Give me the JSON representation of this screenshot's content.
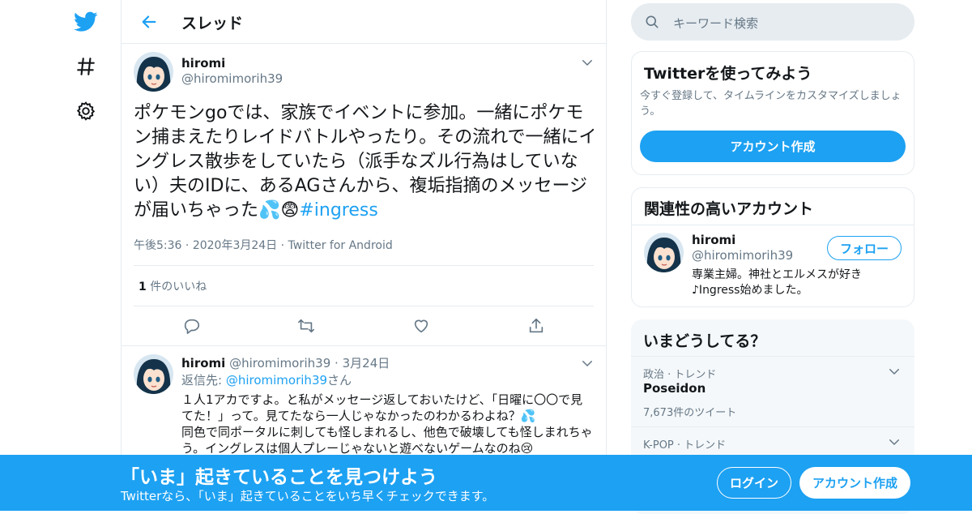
{
  "colors": {
    "accent": "#1da1f2",
    "text": "#14171a",
    "muted": "#657786",
    "border": "#e6ecf0"
  },
  "nav": {
    "icons": [
      "twitter-bird-icon",
      "hashtag-icon",
      "gear-icon"
    ]
  },
  "header": {
    "title": "スレッド"
  },
  "tweet": {
    "name": "hiromi",
    "handle": "@hiromimorih39",
    "text_main": "ポケモンgoでは、家族でイベントに参加。一緒にポケモン捕まえたりレイドバトルやったり。その流れで一緒にイングレス散歩をしていたら（派手なズル行為はしていない）夫のIDに、あるAGさんから、複垢指摘のメッセージが届いちゃった💦😨",
    "hashtag": "#ingress",
    "time": "午後5:36",
    "date": "2020年3月24日",
    "source": "Twitter for Android",
    "likes_count": "1",
    "likes_label": "件のいいね"
  },
  "reply": {
    "name": "hiromi",
    "handle": "@hiromimorih39",
    "date": "3月24日",
    "reply_to_prefix": "返信先:",
    "reply_to_handle": "@hiromimorih39",
    "reply_to_suffix": "さん",
    "text_line1": "１人1アカですよ。と私がメッセージ返しておいたけど、「日曜に〇〇で見てた！」って。見てたなら一人じゃなかったのわかるわよね？💦",
    "text_line2": "同色で同ポータルに刺しても怪しまれるし、他色で破壊しても怪しまれちゃう。イングレスは個人プレーじゃないと遊べないゲームなのね😢"
  },
  "search": {
    "placeholder": "キーワード検索"
  },
  "signup_card": {
    "title": "Twitterを使ってみよう",
    "desc": "今すぐ登録して、タイムラインをカスタマイズしましょう。",
    "button": "アカウント作成"
  },
  "related": {
    "title": "関連性の高いアカウント",
    "name": "hiromi",
    "handle": "@hiromimorih39",
    "follow": "フォロー",
    "bio_line1": "専業主婦。神社とエルメスが好き",
    "bio_line2": "♪Ingress始めました。"
  },
  "trends": {
    "title": "いまどうしてる？",
    "items": [
      {
        "category": "政治 · トレンド",
        "name": "Poseidon",
        "count": "7,673件のツイート"
      },
      {
        "category": "K-POP · トレンド"
      }
    ]
  },
  "banner": {
    "title": "「いま」起きていることを見つけよう",
    "subtitle": "Twitterなら、「いま」起きていることをいち早くチェックできます。",
    "login": "ログイン",
    "signup": "アカウント作成"
  }
}
